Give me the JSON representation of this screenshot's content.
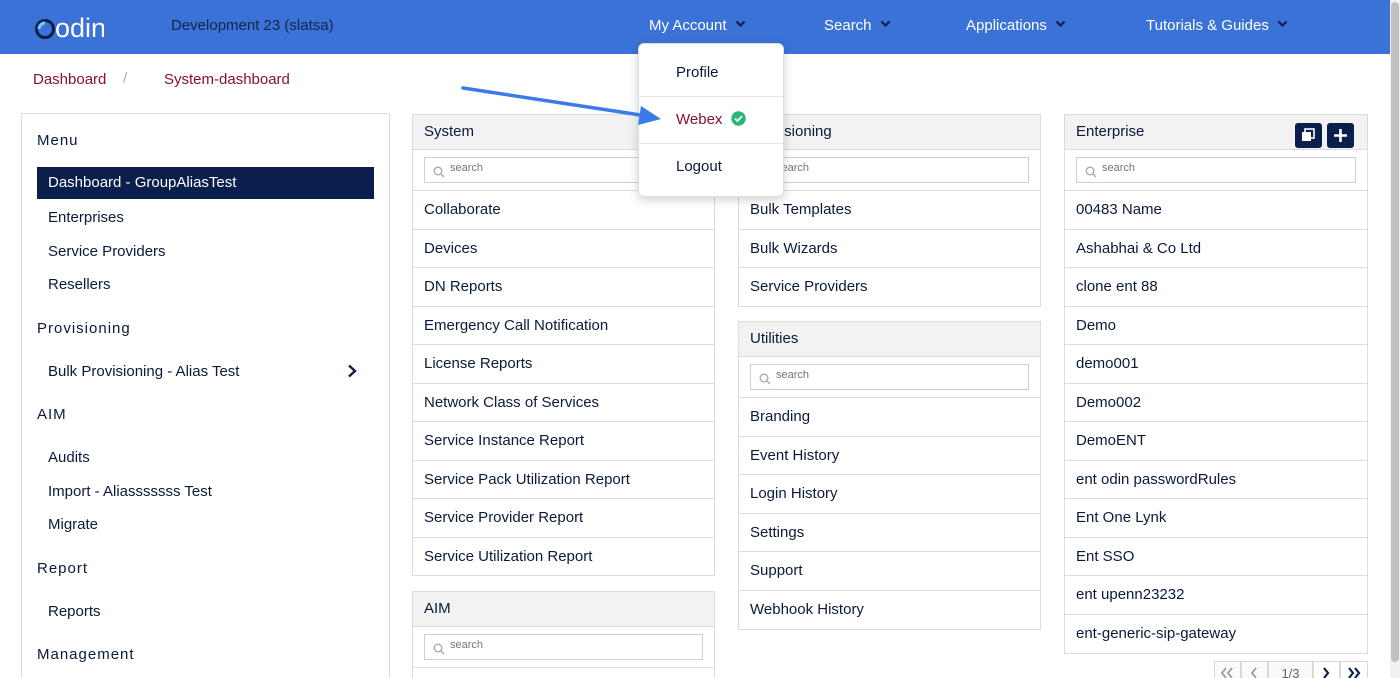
{
  "header": {
    "logo_text": "odin",
    "environment": "Development 23 (slatsa)",
    "nav": [
      "My Account",
      "Search",
      "Applications",
      "Tutorials & Guides"
    ]
  },
  "breadcrumb": {
    "items": [
      "Dashboard",
      "System-dashboard"
    ],
    "separator": "/"
  },
  "account_menu": {
    "items": [
      "Profile",
      "Webex",
      "Logout"
    ]
  },
  "sidebar": {
    "headings": [
      "Menu",
      "Provisioning",
      "AIM",
      "Report",
      "Management"
    ],
    "active_item": "Dashboard - GroupAliasTest",
    "menu_items": [
      "Enterprises",
      "Service Providers",
      "Resellers"
    ],
    "provisioning_items": [
      "Bulk Provisioning - Alias Test"
    ],
    "aim_items": [
      "Audits",
      "Import - Aliasssssss Test",
      "Migrate"
    ],
    "report_items": [
      "Reports"
    ]
  },
  "system_panel": {
    "title": "System",
    "search_placeholder": "search",
    "items": [
      "Collaborate",
      "Devices",
      "DN Reports",
      "Emergency Call Notification",
      "License Reports",
      "Network Class of Services",
      "Service Instance Report",
      "Service Pack Utilization Report",
      "Service Provider Report",
      "Service Utilization Report"
    ]
  },
  "aim_panel": {
    "title": "AIM",
    "search_placeholder": "search"
  },
  "provisioning_panel": {
    "title": "Provisioning",
    "search_placeholder": "search",
    "items": [
      "Bulk Templates",
      "Bulk Wizards",
      "Service Providers"
    ]
  },
  "utilities_panel": {
    "title": "Utilities",
    "search_placeholder": "search",
    "items": [
      "Branding",
      "Event History",
      "Login History",
      "Settings",
      "Support",
      "Webhook History"
    ]
  },
  "enterprise_panel": {
    "title": "Enterprise",
    "search_placeholder": "search",
    "items": [
      "00483 Name",
      "Ashabhai & Co Ltd",
      "clone ent 88",
      "Demo",
      "demo001",
      "Demo002",
      "DemoENT",
      "ent odin passwordRules",
      "Ent One Lynk",
      "Ent SSO",
      "ent upenn23232",
      "ent-generic-sip-gateway"
    ]
  },
  "pagination": {
    "page": "1/3"
  },
  "colors": {
    "topbar": "#3a72d8",
    "navy": "#0b1f4d",
    "crumb": "#8a1030",
    "check": "#2bb673",
    "arrow": "#3a7be8"
  }
}
